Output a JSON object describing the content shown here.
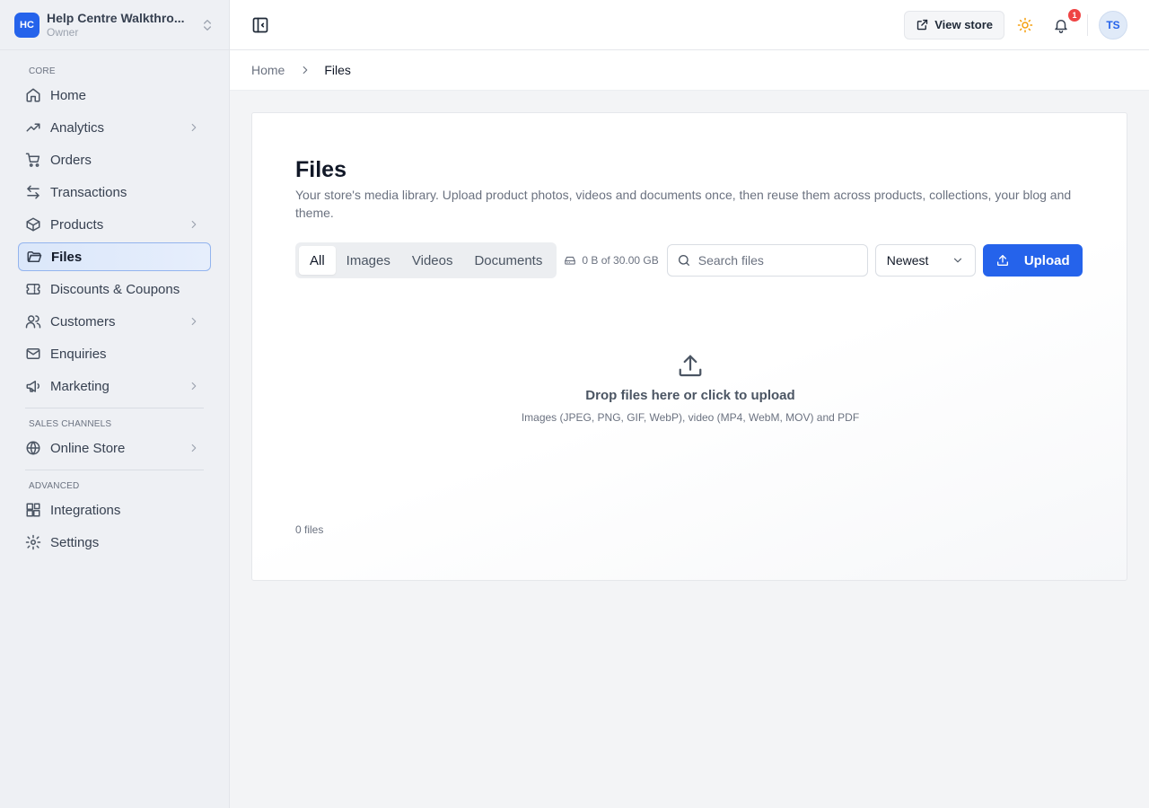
{
  "store": {
    "initials": "HC",
    "name": "Help Centre Walkthro...",
    "role": "Owner"
  },
  "nav": {
    "core_label": "CORE",
    "sales_label": "SALES CHANNELS",
    "advanced_label": "ADVANCED",
    "items": [
      {
        "label": "Home",
        "icon": "home-icon"
      },
      {
        "label": "Analytics",
        "icon": "trend-icon"
      },
      {
        "label": "Orders",
        "icon": "cart-icon"
      },
      {
        "label": "Transactions",
        "icon": "transfer-icon"
      },
      {
        "label": "Products",
        "icon": "box-icon"
      },
      {
        "label": "Files",
        "icon": "folder-icon"
      },
      {
        "label": "Discounts & Coupons",
        "icon": "ticket-icon"
      },
      {
        "label": "Customers",
        "icon": "users-icon"
      },
      {
        "label": "Enquiries",
        "icon": "mail-icon"
      },
      {
        "label": "Marketing",
        "icon": "megaphone-icon"
      },
      {
        "label": "Online Store",
        "icon": "globe-icon"
      },
      {
        "label": "Integrations",
        "icon": "blocks-icon"
      },
      {
        "label": "Settings",
        "icon": "gear-icon"
      }
    ]
  },
  "topbar": {
    "view_store": "View store",
    "notification_count": "1",
    "avatar_initials": "TS"
  },
  "breadcrumb": {
    "home": "Home",
    "current": "Files"
  },
  "page": {
    "title": "Files",
    "description": "Your store's media library. Upload product photos, videos and documents once, then reuse them across products, collections, your blog and theme."
  },
  "tabs": [
    "All",
    "Images",
    "Videos",
    "Documents"
  ],
  "storage": "0 B of 30.00 GB",
  "search": {
    "placeholder": "Search files",
    "value": ""
  },
  "sort": {
    "selected": "Newest"
  },
  "upload_label": "Upload",
  "dropzone": {
    "title": "Drop files here or click to upload",
    "subtitle": "Images (JPEG, PNG, GIF, WebP), video (MP4, WebM, MOV) and PDF"
  },
  "file_count": "0 files",
  "colors": {
    "accent": "#2563eb",
    "active_nav_border": "#93b4ee",
    "badge": "#ef4444",
    "sun": "#f59e0b"
  }
}
